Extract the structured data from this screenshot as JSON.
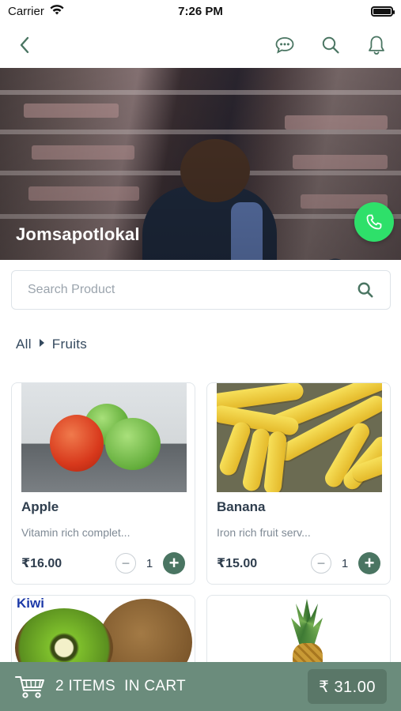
{
  "status_bar": {
    "carrier": "Carrier",
    "time": "7:26 PM"
  },
  "nav": {
    "icons": [
      "back-chevron-icon",
      "chat-bubble-icon",
      "search-icon",
      "bell-icon"
    ]
  },
  "store": {
    "name": "Jomsapotlokal",
    "call_icon": "phone-icon",
    "call_color": "#2ee06a"
  },
  "search": {
    "placeholder": "Search Product",
    "icon": "search-icon"
  },
  "breadcrumb": {
    "root": "All",
    "current": "Fruits"
  },
  "products": [
    {
      "name": "Apple",
      "description": "Vitamin rich complet...",
      "price": "₹16.00",
      "qty": "1"
    },
    {
      "name": "Banana",
      "description": "Iron rich fruit serv...",
      "price": "₹15.00",
      "qty": "1"
    },
    {
      "name": "",
      "image_label": "Kiwi"
    },
    {
      "name": ""
    }
  ],
  "cart": {
    "items_label": "2 ITEMS  IN CART",
    "total": "₹ 31.00",
    "bar_color": "#6b8c7c"
  },
  "colors": {
    "accent": "#4a7562",
    "text_dark": "#2f3e4e",
    "muted": "#7f8a95"
  }
}
